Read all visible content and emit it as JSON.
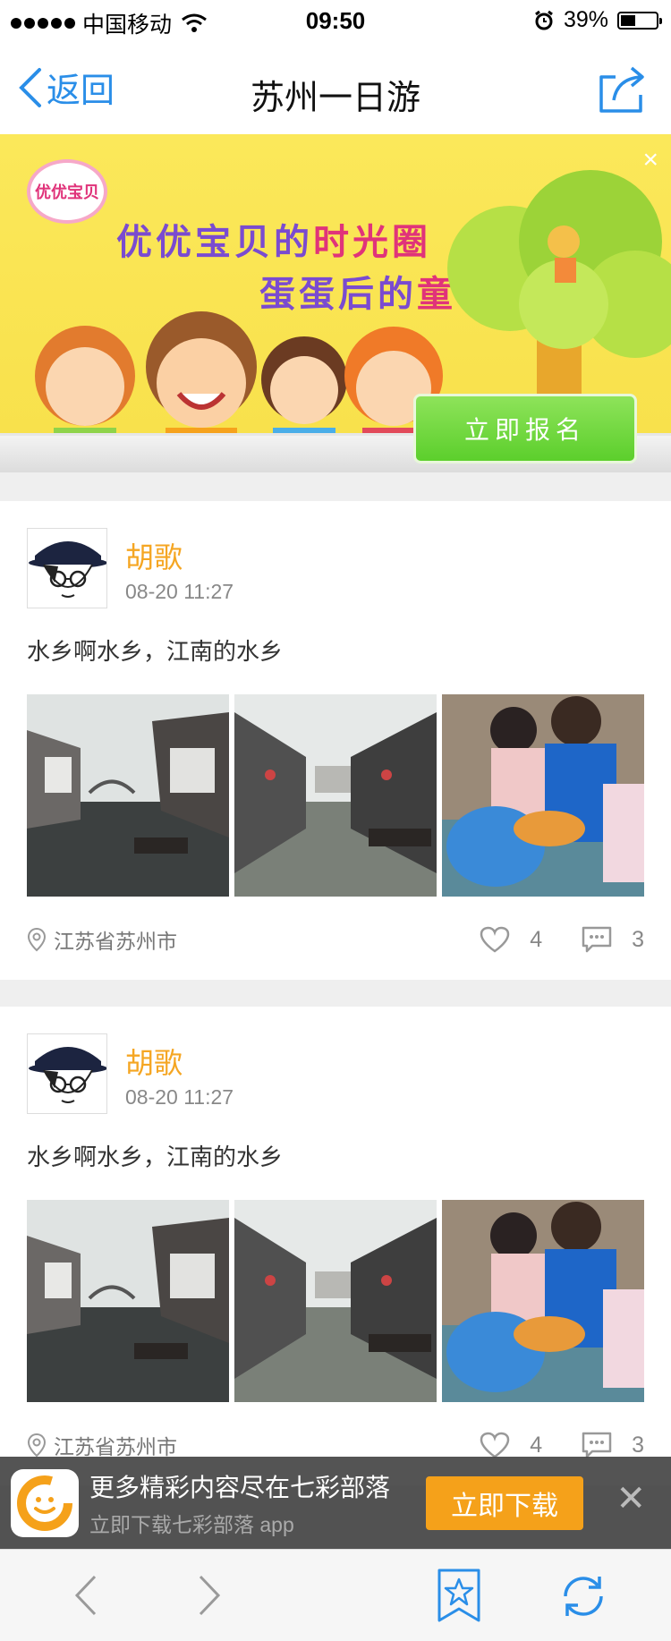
{
  "status_bar": {
    "carrier": "中国移动",
    "time": "09:50",
    "battery": "39%",
    "battery_level": 0.39
  },
  "nav": {
    "back_label": "返回",
    "title": "苏州一日游",
    "share_icon": "share-icon"
  },
  "banner": {
    "logo_text": "优优宝贝",
    "line1_part1": "优优宝贝的",
    "line1_part2": "时光圈",
    "line2_part1": "蛋蛋后的",
    "line2_part2": "童年回忆",
    "signup_label": "立即报名",
    "close_label": "×"
  },
  "posts": [
    {
      "author": "胡歌",
      "time": "08-20 11:27",
      "text": "水乡啊水乡，江南的水乡",
      "location": "江苏省苏州市",
      "likes": "4",
      "comments": "3"
    },
    {
      "author": "胡歌",
      "time": "08-20 11:27",
      "text": "水乡啊水乡，江南的水乡",
      "location": "江苏省苏州市",
      "likes": "4",
      "comments": "3"
    }
  ],
  "promo": {
    "title": "更多精彩内容尽在七彩部落",
    "subtitle": "立即下载七彩部落 app",
    "download_label": "立即下载",
    "close_label": "✕"
  },
  "colors": {
    "accent_blue": "#2a8ee8",
    "author_orange": "#f5a623",
    "signup_green": "#6bd63a",
    "download_orange": "#f5a11a"
  }
}
